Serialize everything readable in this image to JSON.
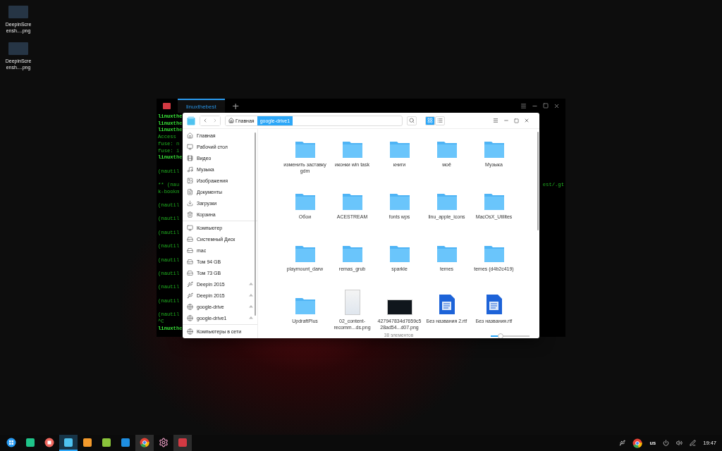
{
  "desktop_icons": [
    {
      "label": "DeepinScreensh....png"
    },
    {
      "label": "DeepinScreensh....png"
    }
  ],
  "terminal": {
    "tabs": [
      {
        "label": "linuxthebest",
        "selected": true
      }
    ],
    "new_tab": "+",
    "blocks": [
      [
        {
          "text": "linuxthe",
          "bold": true
        },
        {
          "text": "linuxthe",
          "bold": true
        },
        {
          "text": "linuxthe",
          "bold": true
        },
        {
          "text": "Access",
          "bold": false
        },
        {
          "text": "fuse: n",
          "bold": false
        },
        {
          "text": "fuse: i",
          "bold": false
        },
        {
          "text": "linuxthe",
          "bold": true
        }
      ],
      [
        {
          "text": "(nautil",
          "bold": false
        }
      ],
      [
        {
          "text": "** (nau",
          "tail": "est/.gt",
          "bold": false
        },
        {
          "text": "k-bookm",
          "bold": false
        }
      ],
      [
        {
          "text": "(nautil",
          "bold": false
        }
      ],
      [
        {
          "text": "(nautil",
          "bold": false
        }
      ],
      [
        {
          "text": "(nautil",
          "bold": false
        }
      ],
      [
        {
          "text": "(nautil",
          "bold": false
        }
      ],
      [
        {
          "text": "(nautil",
          "bold": false
        }
      ],
      [
        {
          "text": "(nautil",
          "bold": false
        }
      ],
      [
        {
          "text": "(nautil",
          "bold": false
        }
      ],
      [
        {
          "text": "(nautil",
          "bold": false
        }
      ],
      [
        {
          "text": "(nautil",
          "bold": false
        },
        {
          "text": "^C",
          "bold": false
        },
        {
          "text": "linuxthe",
          "bold": true
        }
      ]
    ]
  },
  "file_manager": {
    "breadcrumb": [
      {
        "label": "Главная",
        "kind": "home",
        "selected": false
      },
      {
        "label": "google-drive1",
        "kind": "plain",
        "selected": true
      }
    ],
    "views": [
      {
        "kind": "grid",
        "selected": true
      },
      {
        "kind": "list",
        "selected": false
      }
    ],
    "sidebar": [
      [
        {
          "label": "Главная",
          "kind": "home",
          "ejectable": false
        },
        {
          "label": "Рабочий стол",
          "kind": "desktop",
          "ejectable": false
        },
        {
          "label": "Видео",
          "kind": "video",
          "ejectable": false
        },
        {
          "label": "Музыка",
          "kind": "music",
          "ejectable": false
        },
        {
          "label": "Изображения",
          "kind": "pictures",
          "ejectable": false
        },
        {
          "label": "Документы",
          "kind": "documents",
          "ejectable": false
        },
        {
          "label": "Загрузки",
          "kind": "downloads",
          "ejectable": false
        },
        {
          "label": "Корзина",
          "kind": "trash",
          "ejectable": false
        }
      ],
      [
        {
          "label": "Компьютер",
          "kind": "computer",
          "ejectable": false
        },
        {
          "label": "Системный Диск",
          "kind": "disk",
          "ejectable": false
        },
        {
          "label": "mac",
          "kind": "disk",
          "ejectable": false
        },
        {
          "label": "Том 94 GB",
          "kind": "disk",
          "ejectable": false
        },
        {
          "label": "Том 73 GB",
          "kind": "disk",
          "ejectable": false
        },
        {
          "label": "Deepin 2015",
          "kind": "usb",
          "ejectable": true
        },
        {
          "label": "Deepin 2015",
          "kind": "usb",
          "ejectable": true
        },
        {
          "label": "google-drive",
          "kind": "network",
          "ejectable": true
        },
        {
          "label": "google-drive1",
          "kind": "network",
          "ejectable": true
        }
      ],
      [
        {
          "label": "Компьютеры в сети",
          "kind": "network",
          "ejectable": false
        }
      ]
    ],
    "items": [
      {
        "name": "изменить заставку gdm",
        "kind": "folder"
      },
      {
        "name": "иконки win task",
        "kind": "folder"
      },
      {
        "name": "книги",
        "kind": "folder"
      },
      {
        "name": "моё",
        "kind": "folder"
      },
      {
        "name": "Музыка",
        "kind": "folder"
      },
      {
        "name": "Обои",
        "kind": "folder"
      },
      {
        "name": "ACESTREAM",
        "kind": "folder"
      },
      {
        "name": "fonts wps",
        "kind": "folder"
      },
      {
        "name": "linu_apple_icons",
        "kind": "folder"
      },
      {
        "name": "MacOsX_Utilites",
        "kind": "folder"
      },
      {
        "name": "playmount_darw",
        "kind": "folder"
      },
      {
        "name": "remas_grub",
        "kind": "folder"
      },
      {
        "name": "sparkle",
        "kind": "folder"
      },
      {
        "name": "temes",
        "kind": "folder"
      },
      {
        "name": "temes (d4b2c419)",
        "kind": "folder"
      },
      {
        "name": "UpdraftPlus",
        "kind": "folder"
      },
      {
        "name": "02_content-recomm...ds.png",
        "kind": "image"
      },
      {
        "name": "427947834d7659c528ad54...d07.png",
        "kind": "photo"
      },
      {
        "name": "Без названия 2.rtf",
        "kind": "document"
      },
      {
        "name": "Без названия.rtf",
        "kind": "document"
      }
    ],
    "status": "38 элементов",
    "zoom": {
      "level": 0.25
    }
  },
  "taskbar": {
    "apps": [
      {
        "kind": "launcher",
        "selected": false,
        "running": false
      },
      {
        "kind": "notes",
        "selected": false,
        "running": false
      },
      {
        "kind": "record",
        "selected": false,
        "running": false
      },
      {
        "kind": "files",
        "selected": true,
        "running": true
      },
      {
        "kind": "store",
        "selected": false,
        "running": false
      },
      {
        "kind": "music",
        "selected": false,
        "running": false
      },
      {
        "kind": "video",
        "selected": false,
        "running": false
      },
      {
        "kind": "browser",
        "selected": false,
        "running": true
      },
      {
        "kind": "settings",
        "selected": false,
        "running": false
      },
      {
        "kind": "terminal",
        "selected": false,
        "running": true
      }
    ],
    "keyboard": "us",
    "clock": "19:47"
  }
}
